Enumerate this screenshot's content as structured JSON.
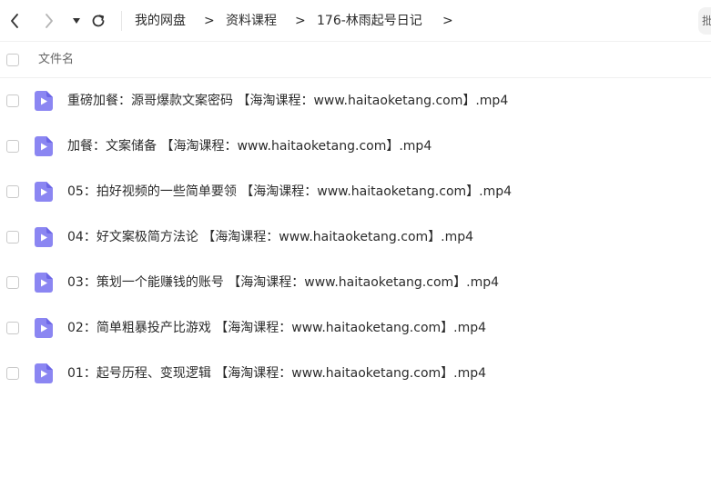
{
  "breadcrumb": {
    "items": [
      "我的网盘",
      "资料课程",
      "176-林雨起号日记"
    ],
    "separator": ">"
  },
  "header": {
    "column_label": "文件名"
  },
  "edge_widget_label": "批",
  "files": [
    {
      "name": "重磅加餐：源哥爆款文案密码 【海淘课程：www.haitaoketang.com】.mp4",
      "icon": "video-file-icon"
    },
    {
      "name": "加餐：文案储备 【海淘课程：www.haitaoketang.com】.mp4",
      "icon": "video-file-icon"
    },
    {
      "name": "05：拍好视频的一些简单要领 【海淘课程：www.haitaoketang.com】.mp4",
      "icon": "video-file-icon"
    },
    {
      "name": "04：好文案极简方法论 【海淘课程：www.haitaoketang.com】.mp4",
      "icon": "video-file-icon"
    },
    {
      "name": "03：策划一个能赚钱的账号 【海淘课程：www.haitaoketang.com】.mp4",
      "icon": "video-file-icon"
    },
    {
      "name": "02：简单粗暴投产比游戏 【海淘课程：www.haitaoketang.com】.mp4",
      "icon": "video-file-icon"
    },
    {
      "name": "01：起号历程、变现逻辑 【海淘课程：www.haitaoketang.com】.mp4",
      "icon": "video-file-icon"
    }
  ],
  "colors": {
    "icon_purple": "#8b86f2",
    "icon_purple_dark": "#6c66e6",
    "text": "#2b2b2b",
    "muted": "#666666"
  }
}
